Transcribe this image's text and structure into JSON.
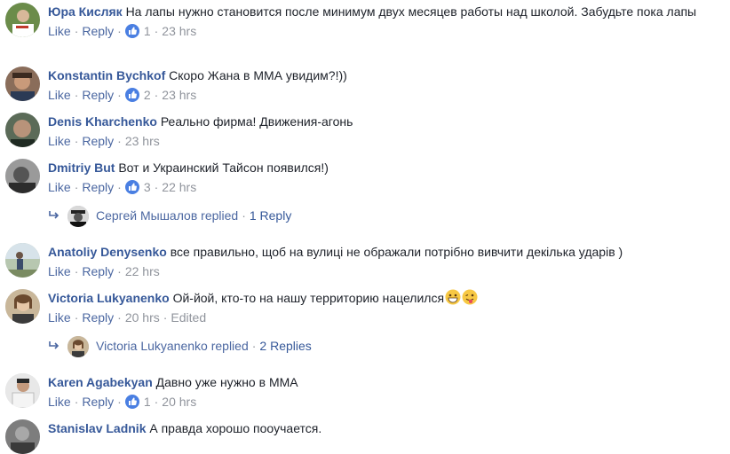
{
  "actions": {
    "like": "Like",
    "reply": "Reply",
    "separator": "·",
    "edited": "Edited"
  },
  "comments": [
    {
      "author": "Юра Кисляк",
      "text": "На лапы нужно становится после минимум двух месяцев работы над школой. Забудьте пока лапы",
      "likes": "1",
      "time": "23 hrs"
    },
    {
      "author": "Konstantin Bychkof",
      "text": "Скоро Жана в ММА увидим?!))",
      "likes": "2",
      "time": "23 hrs"
    },
    {
      "author": "Denis Kharchenko",
      "text": "Реально фирма! Движения-агонь",
      "likes": "",
      "time": "23 hrs"
    },
    {
      "author": "Dmitriy But",
      "text": "Вот и Украинский Тайсон появился!)",
      "likes": "3",
      "time": "22 hrs",
      "replies": {
        "who": "Сергей Мышалов replied",
        "count": "1 Reply"
      }
    },
    {
      "author": "Anatoliy Denysenko",
      "text": "все правильно, щоб на вулиці не ображали потрібно вивчити декілька ударів )",
      "likes": "",
      "time": "22 hrs"
    },
    {
      "author": "Victoria Lukyanenko",
      "text": "Ой-йой, кто-то на нашу территорию нацелился",
      "likes": "",
      "time": "20 hrs",
      "edited": true,
      "emoji": [
        "grinning-emoji",
        "winking-tongue-emoji"
      ],
      "replies": {
        "who": "Victoria Lukyanenko replied",
        "count": "2 Replies"
      }
    },
    {
      "author": "Karen Agabekyan",
      "text": "Давно уже нужно в ММА",
      "likes": "1",
      "time": "20 hrs"
    },
    {
      "author": "Stanislav Ladnik",
      "text": "А правда хорошо поoучается.",
      "likes": "",
      "time": ""
    }
  ],
  "colors": {
    "author": "#365899",
    "action_link": "#4b67a1",
    "meta_gray": "#90949c",
    "like_badge": "#4a7fe2",
    "text": "#1d2129"
  }
}
